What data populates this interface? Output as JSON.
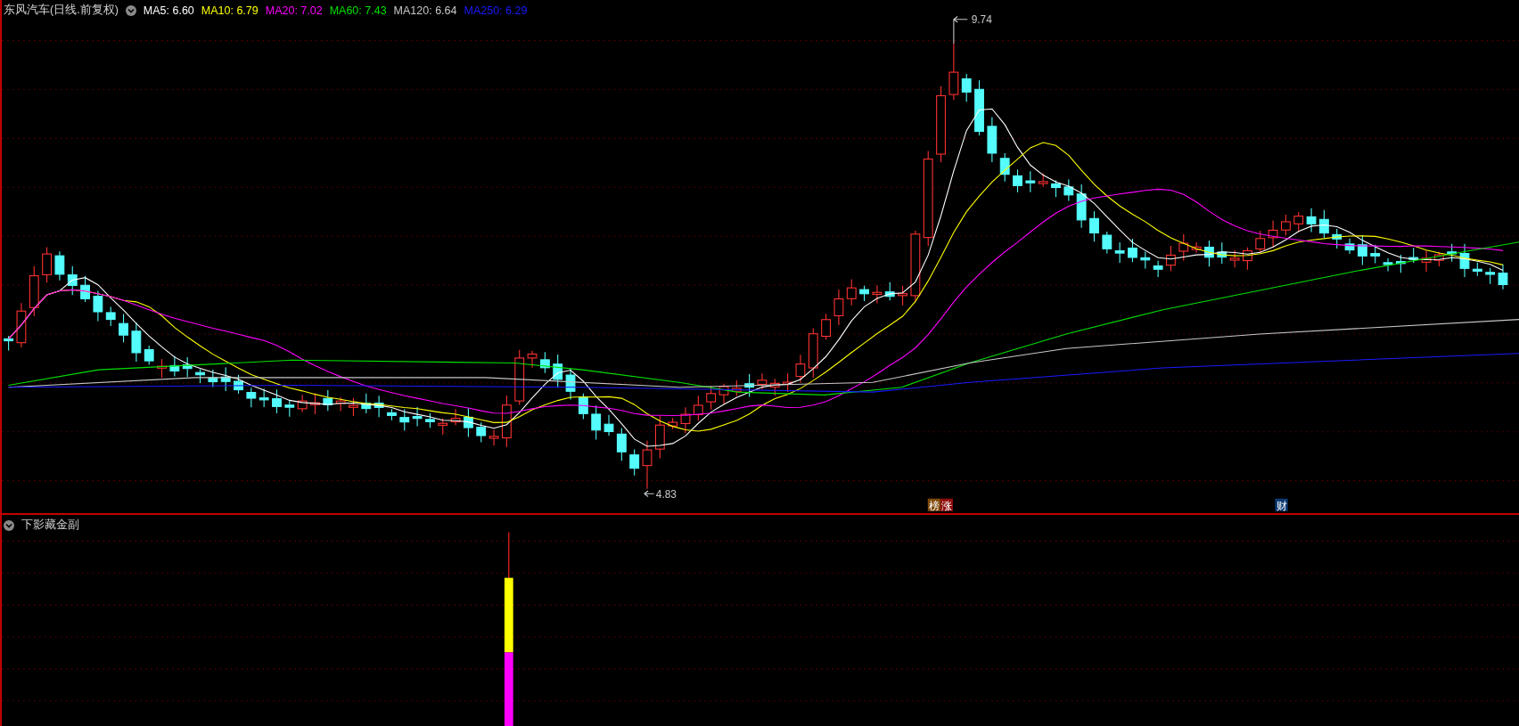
{
  "chart": {
    "title": "东风汽车(日线.前复权)",
    "indicators": [
      {
        "label": "MA5: 6.60",
        "color": "#ffffff"
      },
      {
        "label": "MA10: 6.79",
        "color": "#ffff00"
      },
      {
        "label": "MA20: 7.02",
        "color": "#ff00ff"
      },
      {
        "label": "MA60: 7.43",
        "color": "#00e000"
      },
      {
        "label": "MA120: 6.64",
        "color": "#c8c8c8"
      },
      {
        "label": "MA250: 6.29",
        "color": "#1a1aff"
      }
    ],
    "high_label": "9.74",
    "low_label": "4.83",
    "badges": [
      {
        "text": "榜",
        "color": "#7f4a0a"
      },
      {
        "text": "涨",
        "color": "#8e0c0c"
      },
      {
        "text": "财",
        "color": "#0c3a72"
      }
    ]
  },
  "sub_chart": {
    "title": "下影藏金副"
  }
}
